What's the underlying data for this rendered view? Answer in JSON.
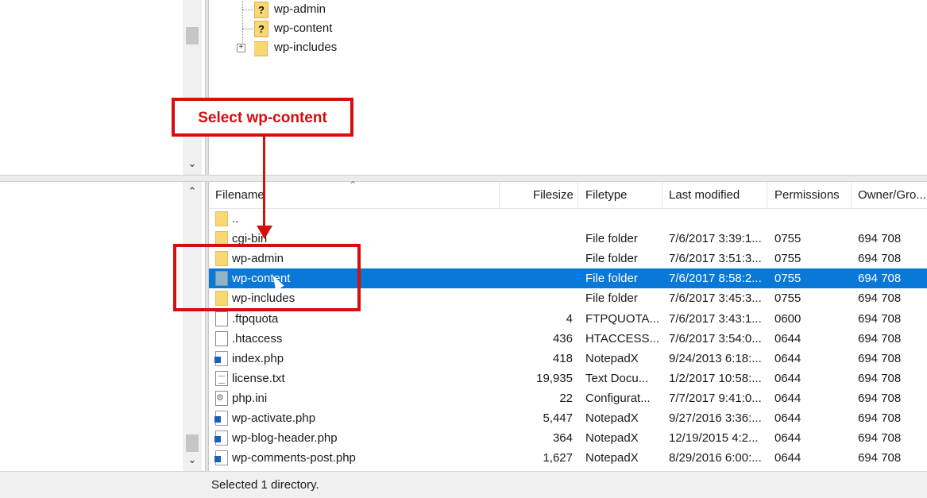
{
  "tree": {
    "items": [
      {
        "label": "wp-admin",
        "icon": "unknown-folder-icon"
      },
      {
        "label": "wp-content",
        "icon": "unknown-folder-icon"
      },
      {
        "label": "wp-includes",
        "icon": "folder-icon"
      }
    ],
    "expander": "+"
  },
  "annotation": {
    "callout_text": "Select wp-content",
    "color": "#d80d0d"
  },
  "list": {
    "columns": [
      "Filename",
      "Filesize",
      "Filetype",
      "Last modified",
      "Permissions",
      "Owner/Gro..."
    ],
    "rows": [
      {
        "name": "..",
        "size": "",
        "type": "",
        "modified": "",
        "perm": "",
        "owner": "",
        "icon": "folder-icon"
      },
      {
        "name": "cgi-bin",
        "size": "",
        "type": "File folder",
        "modified": "7/6/2017 3:39:1...",
        "perm": "0755",
        "owner": "694 708",
        "icon": "folder-icon"
      },
      {
        "name": "wp-admin",
        "size": "",
        "type": "File folder",
        "modified": "7/6/2017 3:51:3...",
        "perm": "0755",
        "owner": "694 708",
        "icon": "folder-icon"
      },
      {
        "name": "wp-content",
        "size": "",
        "type": "File folder",
        "modified": "7/6/2017 8:58:2...",
        "perm": "0755",
        "owner": "694 708",
        "icon": "folder-icon",
        "selected": true
      },
      {
        "name": "wp-includes",
        "size": "",
        "type": "File folder",
        "modified": "7/6/2017 3:45:3...",
        "perm": "0755",
        "owner": "694 708",
        "icon": "folder-icon"
      },
      {
        "name": ".ftpquota",
        "size": "4",
        "type": "FTPQUOTA...",
        "modified": "7/6/2017 3:43:1...",
        "perm": "0600",
        "owner": "694 708",
        "icon": "file-icon"
      },
      {
        "name": ".htaccess",
        "size": "436",
        "type": "HTACCESS...",
        "modified": "7/6/2017 3:54:0...",
        "perm": "0644",
        "owner": "694 708",
        "icon": "file-icon"
      },
      {
        "name": "index.php",
        "size": "418",
        "type": "NotepadX",
        "modified": "9/24/2013 6:18:...",
        "perm": "0644",
        "owner": "694 708",
        "icon": "php-file-icon"
      },
      {
        "name": "license.txt",
        "size": "19,935",
        "type": "Text Docu...",
        "modified": "1/2/2017 10:58:...",
        "perm": "0644",
        "owner": "694 708",
        "icon": "text-file-icon"
      },
      {
        "name": "php.ini",
        "size": "22",
        "type": "Configurat...",
        "modified": "7/7/2017 9:41:0...",
        "perm": "0644",
        "owner": "694 708",
        "icon": "config-file-icon"
      },
      {
        "name": "wp-activate.php",
        "size": "5,447",
        "type": "NotepadX",
        "modified": "9/27/2016 3:36:...",
        "perm": "0644",
        "owner": "694 708",
        "icon": "php-file-icon"
      },
      {
        "name": "wp-blog-header.php",
        "size": "364",
        "type": "NotepadX",
        "modified": "12/19/2015 4:2...",
        "perm": "0644",
        "owner": "694 708",
        "icon": "php-file-icon"
      },
      {
        "name": "wp-comments-post.php",
        "size": "1,627",
        "type": "NotepadX",
        "modified": "8/29/2016 6:00:...",
        "perm": "0644",
        "owner": "694 708",
        "icon": "php-file-icon"
      }
    ]
  },
  "status": {
    "text": "Selected 1 directory."
  },
  "colors": {
    "selection": "#0a78d7",
    "folder": "#f8d775"
  }
}
